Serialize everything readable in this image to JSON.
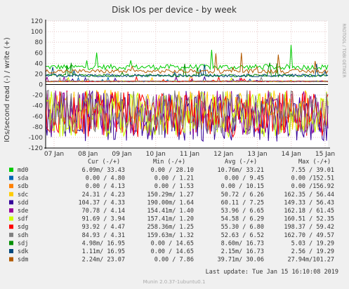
{
  "chart_data": {
    "type": "line",
    "title": "Disk IOs per device - by week",
    "ylabel": "IOs/second read (-) / write (+)",
    "side_label": "RRDTOOL / TOBI OETIKER",
    "ylim": [
      -120,
      120
    ],
    "yticks": [
      120,
      100,
      80,
      60,
      40,
      20,
      0,
      -20,
      -40,
      -60,
      -80,
      -100,
      -120
    ],
    "xlabels": [
      "07 Jan",
      "08 Jan",
      "09 Jan",
      "10 Jan",
      "11 Jan",
      "12 Jan",
      "13 Jan",
      "14 Jan",
      "15 Jan"
    ],
    "grid": true,
    "legend_position": "bottom",
    "legend_headers": {
      "cur": "Cur (-/+)",
      "min": "Min (-/+)",
      "avg": "Avg (-/+)",
      "max": "Max (-/+)"
    },
    "series": [
      {
        "name": "md0",
        "color": "#00cc00",
        "cur": "6.09m/ 33.43",
        "min": "0.00 / 28.10",
        "avg": "10.76m/ 33.21",
        "max": "7.55 / 39.01",
        "write_level": 33,
        "read_level": 0
      },
      {
        "name": "sda",
        "color": "#0066b3",
        "cur": "0.00 / 4.80",
        "min": "0.00 / 1.21",
        "avg": "0.00 / 9.45",
        "max": "0.00 /152.51",
        "write_level": 6,
        "read_level": 0
      },
      {
        "name": "sdb",
        "color": "#ff8000",
        "cur": "0.00 / 4.13",
        "min": "0.00 / 1.53",
        "avg": "0.00 / 10.15",
        "max": "0.00 /156.92",
        "write_level": 6,
        "read_level": 0
      },
      {
        "name": "sdc",
        "color": "#ffcc00",
        "cur": "24.31 / 4.23",
        "min": "150.29m/ 1.27",
        "avg": "50.72 / 6.26",
        "max": "162.35 / 56.44",
        "write_level": 6,
        "read_level": 50
      },
      {
        "name": "sdd",
        "color": "#330099",
        "cur": "104.37 / 4.33",
        "min": "190.00m/ 1.64",
        "avg": "60.11 / 7.25",
        "max": "149.33 / 56.43",
        "write_level": 6,
        "read_level": 60
      },
      {
        "name": "sde",
        "color": "#990099",
        "cur": "70.78 / 4.14",
        "min": "154.41m/ 1.40",
        "avg": "53.96 / 6.65",
        "max": "162.18 / 61.45",
        "write_level": 6,
        "read_level": 54
      },
      {
        "name": "sdf",
        "color": "#ccff00",
        "cur": "91.69 / 3.94",
        "min": "157.41m/ 1.20",
        "avg": "54.58 / 6.29",
        "max": "160.51 / 52.35",
        "write_level": 6,
        "read_level": 55
      },
      {
        "name": "sdg",
        "color": "#ff0000",
        "cur": "93.92 / 4.47",
        "min": "258.36m/ 1.25",
        "avg": "55.30 / 6.80",
        "max": "198.37 / 59.42",
        "write_level": 6,
        "read_level": 55
      },
      {
        "name": "sdh",
        "color": "#808080",
        "cur": "84.93 / 4.31",
        "min": "159.63m/ 1.32",
        "avg": "52.63 / 6.52",
        "max": "162.70 / 49.57",
        "write_level": 6,
        "read_level": 53
      },
      {
        "name": "sdj",
        "color": "#008f00",
        "cur": "4.98m/ 16.95",
        "min": "0.00 / 14.65",
        "avg": "8.60m/ 16.73",
        "max": "5.03 / 19.29",
        "write_level": 17,
        "read_level": 0
      },
      {
        "name": "sdk",
        "color": "#00487d",
        "cur": "1.11m/ 16.95",
        "min": "0.00 / 14.65",
        "avg": "2.15m/ 16.73",
        "max": "2.56 / 19.29",
        "write_level": 17,
        "read_level": 0
      },
      {
        "name": "sdm",
        "color": "#b35a00",
        "cur": "2.24m/ 23.07",
        "min": "0.00 / 7.86",
        "avg": "39.71m/ 30.06",
        "max": "27.94m/101.27",
        "write_level": 25,
        "read_level": 0
      }
    ],
    "last_update": "Last update: Tue Jan 15 16:10:08 2019",
    "footer": "Munin 2.0.37-1ubuntu0.1"
  }
}
